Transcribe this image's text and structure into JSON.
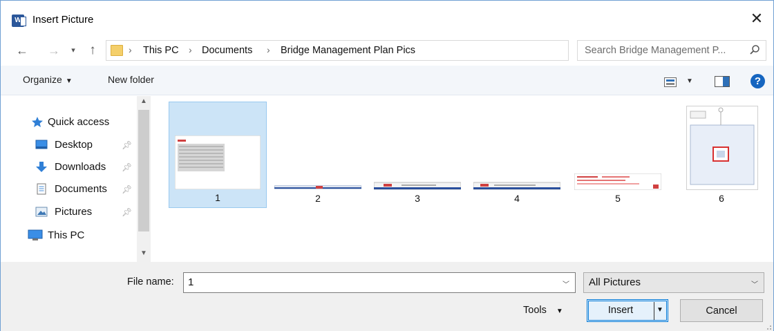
{
  "window": {
    "title": "Insert Picture",
    "app_icon_letter": "W"
  },
  "address": {
    "breadcrumbs": [
      "This PC",
      "Documents",
      "Bridge Management Plan Pics"
    ],
    "separator": "›"
  },
  "search": {
    "placeholder": "Search Bridge Management P..."
  },
  "toolbar": {
    "organize_label": "Organize",
    "new_folder_label": "New folder",
    "help_label": "?"
  },
  "nav_pane": {
    "items": [
      {
        "label": "Quick access",
        "icon": "star-icon"
      },
      {
        "label": "Desktop",
        "icon": "desktop-icon",
        "pinned": true
      },
      {
        "label": "Downloads",
        "icon": "download-arrow-icon",
        "pinned": true
      },
      {
        "label": "Documents",
        "icon": "document-icon",
        "pinned": true
      },
      {
        "label": "Pictures",
        "icon": "pictures-icon",
        "pinned": true
      },
      {
        "label": "This PC",
        "icon": "computer-icon"
      }
    ]
  },
  "files": [
    {
      "label": "1",
      "selected": true
    },
    {
      "label": "2",
      "selected": false
    },
    {
      "label": "3",
      "selected": false
    },
    {
      "label": "4",
      "selected": false
    },
    {
      "label": "5",
      "selected": false
    },
    {
      "label": "6",
      "selected": false
    }
  ],
  "bottom": {
    "file_name_label": "File name:",
    "file_name_value": "1",
    "file_type_value": "All Pictures",
    "tools_label": "Tools",
    "insert_label": "Insert",
    "cancel_label": "Cancel"
  },
  "colors": {
    "selection": "#cce4f7",
    "accent": "#0078d7",
    "toolbar_bg": "#f3f6fa",
    "footer_bg": "#f0f0f0"
  }
}
